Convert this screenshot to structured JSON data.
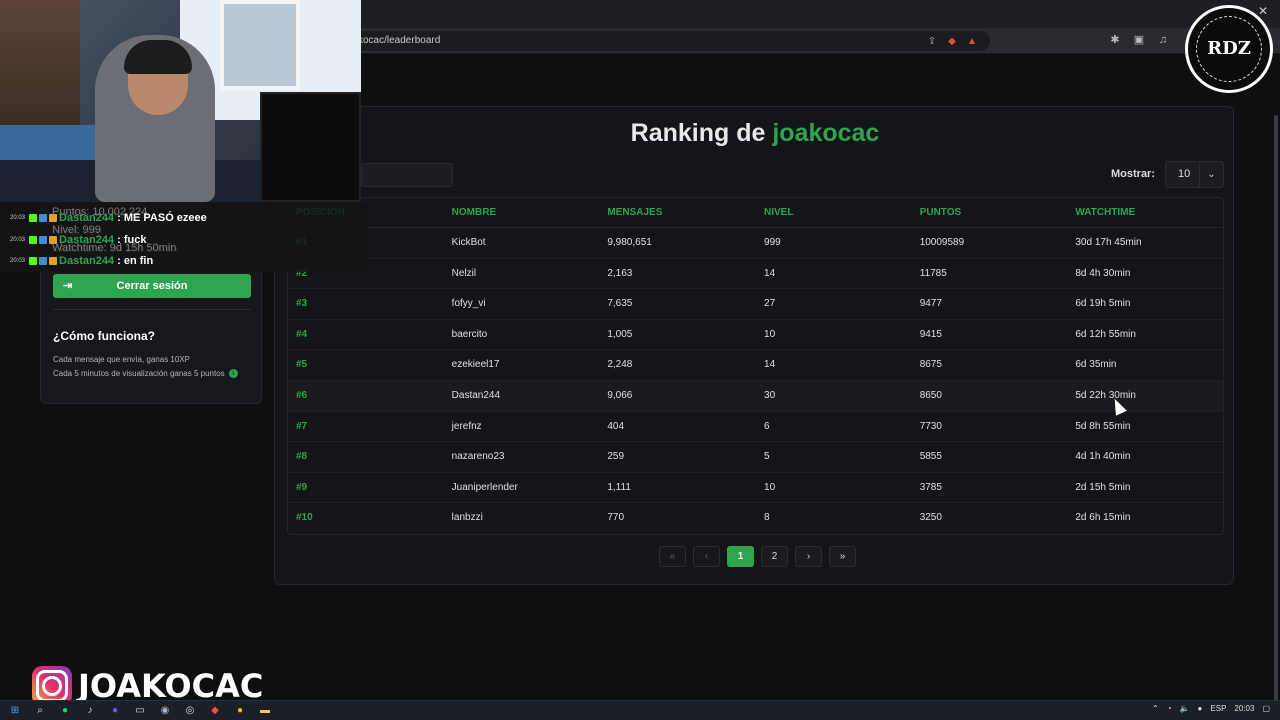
{
  "browser": {
    "url": "kocac/leaderboard"
  },
  "sidebar": {
    "stats": {
      "points": "Puntos: 10,002,224",
      "level": "Nivel: 999",
      "watchtime": "Watchtime: 9d 15h 50min"
    },
    "logout_label": "Cerrar sesión",
    "how_title": "¿Cómo funciona?",
    "how_line_1": "Cada mensaje que envía, ganas 10XP",
    "how_line_2": "Cada 5 minutos de visualización ganas 5 puntos"
  },
  "main": {
    "title_prefix": "Ranking de ",
    "title_name": "joakocac",
    "show_label": "Mostrar:",
    "show_value": "10",
    "columns": [
      "POSICION",
      "NOMBRE",
      "MENSAJES",
      "NIVEL",
      "PUNTOS",
      "WATCHTIME"
    ],
    "rows": [
      {
        "pos": "#1",
        "name": "KickBot",
        "msgs": "9,980,651",
        "level": "999",
        "points": "10009589",
        "watch": "30d 17h 45min"
      },
      {
        "pos": "#2",
        "name": "Nelzil",
        "msgs": "2,163",
        "level": "14",
        "points": "11785",
        "watch": "8d 4h 30min"
      },
      {
        "pos": "#3",
        "name": "fofyy_vi",
        "msgs": "7,635",
        "level": "27",
        "points": "9477",
        "watch": "6d 19h 5min"
      },
      {
        "pos": "#4",
        "name": "baercito",
        "msgs": "1,005",
        "level": "10",
        "points": "9415",
        "watch": "6d 12h 55min"
      },
      {
        "pos": "#5",
        "name": "ezekieel17",
        "msgs": "2,248",
        "level": "14",
        "points": "8675",
        "watch": "6d 35min"
      },
      {
        "pos": "#6",
        "name": "Dastan244",
        "msgs": "9,066",
        "level": "30",
        "points": "8650",
        "watch": "5d 22h 30min"
      },
      {
        "pos": "#7",
        "name": "jerefnz",
        "msgs": "404",
        "level": "6",
        "points": "7730",
        "watch": "5d 8h 55min"
      },
      {
        "pos": "#8",
        "name": "nazareno23",
        "msgs": "259",
        "level": "5",
        "points": "5855",
        "watch": "4d 1h 40min"
      },
      {
        "pos": "#9",
        "name": "Juaniperlender",
        "msgs": "1,111",
        "level": "10",
        "points": "3785",
        "watch": "2d 15h 5min"
      },
      {
        "pos": "#10",
        "name": "lanbzzi",
        "msgs": "770",
        "level": "8",
        "points": "3250",
        "watch": "2d 6h 15min"
      }
    ],
    "pager": {
      "first": "«",
      "prev": "‹",
      "page1": "1",
      "page2": "2",
      "next": "›",
      "last": "»"
    }
  },
  "chat": [
    {
      "time": "20:03",
      "user": "Dastan244",
      "msg": " : ME PASÓ ezeee"
    },
    {
      "time": "20:03",
      "user": "Dastan244",
      "msg": " : fuck"
    },
    {
      "time": "20:03",
      "user": "Dastan244",
      "msg": " : en fin"
    }
  ],
  "logo": {
    "mono": "RDZ"
  },
  "watermark": {
    "handle": "JOAKOCAC"
  },
  "taskbar": {
    "lang": "ESP",
    "time": "20:03"
  },
  "colors": {
    "accent": "#2ea44f",
    "background": "#0e0f11",
    "card": "#141518"
  }
}
